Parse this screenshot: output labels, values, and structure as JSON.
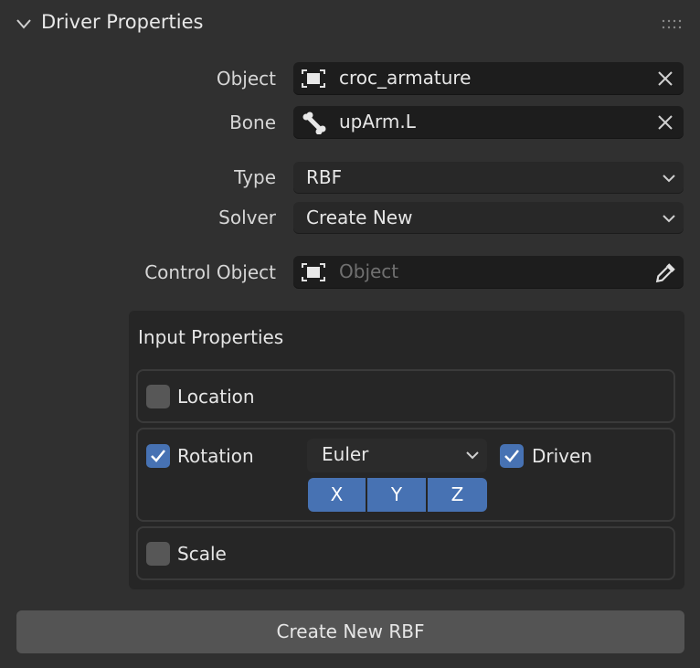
{
  "panel": {
    "title": "Driver Properties"
  },
  "fields": {
    "object": {
      "label": "Object",
      "value": "croc_armature"
    },
    "bone": {
      "label": "Bone",
      "value": "upArm.L"
    },
    "type": {
      "label": "Type",
      "value": "RBF"
    },
    "solver": {
      "label": "Solver",
      "value": "Create New"
    },
    "control_object": {
      "label": "Control Object",
      "placeholder": "Object"
    }
  },
  "input_properties": {
    "title": "Input Properties",
    "location": {
      "label": "Location",
      "checked": false
    },
    "rotation": {
      "label": "Rotation",
      "checked": true,
      "mode": "Euler",
      "driven_label": "Driven",
      "driven_checked": true,
      "axes": [
        "X",
        "Y",
        "Z"
      ]
    },
    "scale": {
      "label": "Scale",
      "checked": false
    }
  },
  "action_button": {
    "label": "Create New RBF"
  },
  "colors": {
    "accent": "#4772b3",
    "panel_bg": "#303030",
    "field_bg": "#1d1d1d"
  },
  "icons": [
    "chevron-down-icon",
    "grip-icon",
    "object-icon",
    "bone-icon",
    "clear-icon",
    "dropdown-arrow-icon",
    "eyedropper-icon",
    "checkmark-icon"
  ]
}
